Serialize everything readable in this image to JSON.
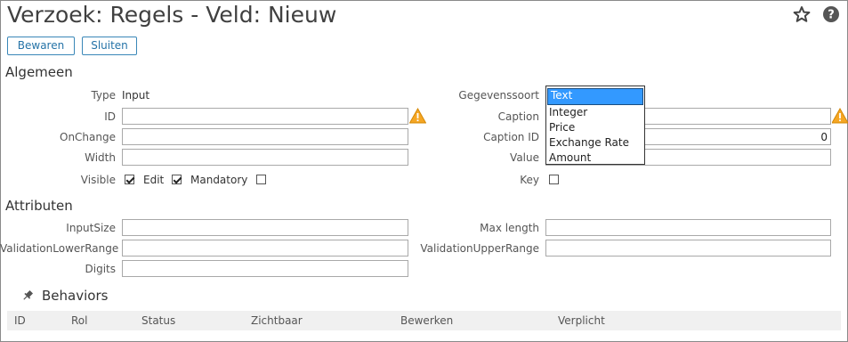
{
  "header": {
    "title": "Verzoek: Regels - Veld: Nieuw",
    "favorite_icon": "star-icon",
    "help_icon": "help-icon"
  },
  "toolbar": {
    "save_label": "Bewaren",
    "close_label": "Sluiten"
  },
  "general": {
    "section_title": "Algemeen",
    "type_label": "Type",
    "type_value": "Input",
    "id_label": "ID",
    "id_value": "",
    "onchange_label": "OnChange",
    "onchange_value": "",
    "width_label": "Width",
    "width_value": "",
    "visible_label": "Visible",
    "visible_checked": true,
    "edit_label": "Edit",
    "edit_checked": true,
    "mandatory_label": "Mandatory",
    "mandatory_checked": false,
    "datatype_label": "Gegevenssoort",
    "datatype_selected": "Text",
    "datatype_options": [
      "Text",
      "Integer",
      "Price",
      "Exchange Rate",
      "Amount"
    ],
    "caption_label": "Caption",
    "caption_value": "",
    "caption_id_label": "Caption ID",
    "caption_id_value": "0",
    "value_label": "Value",
    "value_value": "",
    "key_label": "Key",
    "key_checked": false,
    "warning_icon": "warning-icon"
  },
  "attributes": {
    "section_title": "Attributen",
    "inputsize_label": "InputSize",
    "inputsize_value": "",
    "vlr_label": "ValidationLowerRange",
    "vlr_value": "",
    "digits_label": "Digits",
    "digits_value": "",
    "maxlength_label": "Max length",
    "maxlength_value": "",
    "vur_label": "ValidationUpperRange",
    "vur_value": ""
  },
  "behaviors": {
    "section_title": "Behaviors",
    "pin_icon": "pin-icon",
    "columns": [
      "ID",
      "Rol",
      "Status",
      "Zichtbaar",
      "Bewerken",
      "Verplicht"
    ]
  },
  "colors": {
    "accent": "#2573a7",
    "warning": "#f5a623",
    "selection": "#3399ff"
  }
}
